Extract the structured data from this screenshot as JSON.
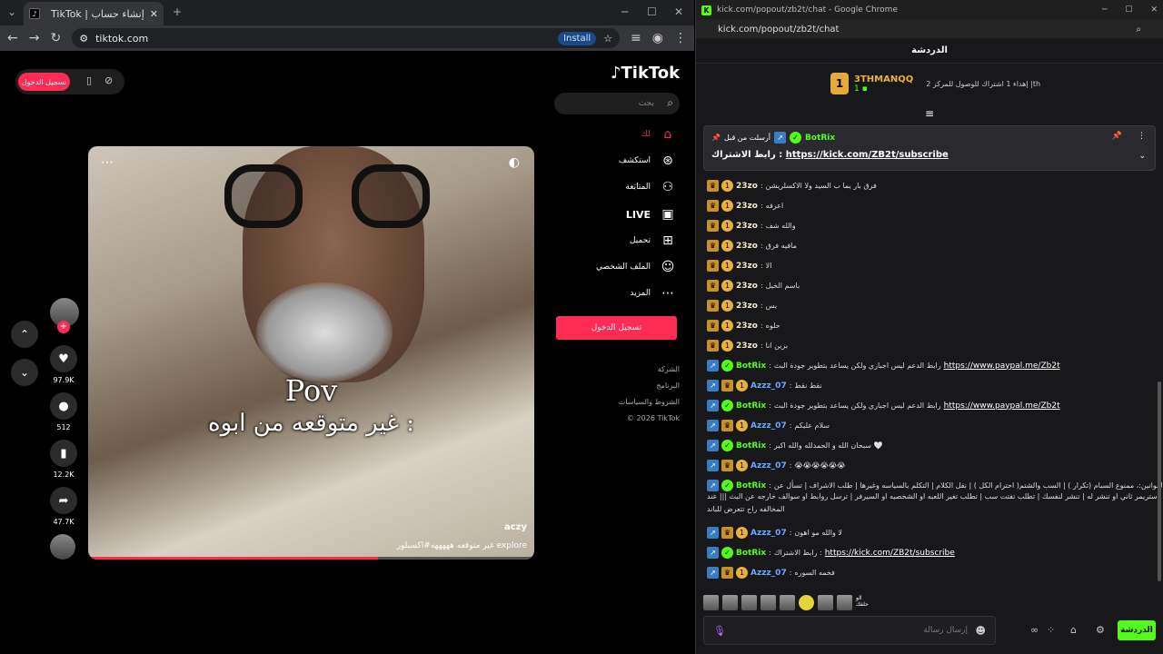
{
  "left_browser": {
    "tab_title": "TikTok | إنشاء حساب",
    "url": "tiktok.com",
    "install_label": "Install"
  },
  "tiktok": {
    "logo": "TikTok",
    "login_pill": "تسجيل الدخول",
    "search_placeholder": "بحث",
    "nav": [
      {
        "label": "لك",
        "icon": "home-icon"
      },
      {
        "label": "استكشف",
        "icon": "compass-icon"
      },
      {
        "label": "المتابَعة",
        "icon": "following-icon"
      },
      {
        "label": "LIVE",
        "icon": "live-icon"
      },
      {
        "label": "تحميل",
        "icon": "upload-icon"
      },
      {
        "label": "الملف الشخصي",
        "icon": "profile-icon"
      },
      {
        "label": "المزيد",
        "icon": "more-icon"
      }
    ],
    "login_button": "تسجيل الدخول",
    "footer": [
      "الشركة",
      "البرنامج",
      "الشروط والسياسات",
      "© 2026 TikTok"
    ],
    "video": {
      "overlay_title": "Pov",
      "overlay_text": "غير متوقعه من ابوه :",
      "username": "aczy",
      "caption": "غير متوقعه هههههه#اكسبلور explore",
      "progress": 0.65
    },
    "actions": {
      "likes": "97.9K",
      "comments": "512",
      "saves": "12.2K",
      "shares": "47.7K"
    }
  },
  "right_browser": {
    "title": "kick.com/popout/zb2t/chat - Google Chrome",
    "url": "kick.com/popout/zb2t/chat"
  },
  "kick": {
    "header": "الدردشة",
    "top_gifter": {
      "name": "3THMANQQ",
      "rank": "1",
      "count": "1"
    },
    "top_gift_note": "إهداء 1 اشتراك للوصول للمركز 2 |th",
    "pinned": {
      "by": "أرسلت من قبل",
      "user": "BotRix",
      "text": "رابط الاشتراك :",
      "link": "https://kick.com/ZB2t/subscribe"
    },
    "messages": [
      {
        "user": "23zo",
        "color": "#f0e6c8",
        "type": "sub",
        "text": "فرق بار يما ب السيد ولا الاكسلريشن"
      },
      {
        "user": "23zo",
        "color": "#f0e6c8",
        "type": "sub",
        "text": "اعرفه"
      },
      {
        "user": "23zo",
        "color": "#f0e6c8",
        "type": "sub",
        "text": "والله شف"
      },
      {
        "user": "23zo",
        "color": "#f0e6c8",
        "type": "sub",
        "text": "مافيه فرق"
      },
      {
        "user": "23zo",
        "color": "#f0e6c8",
        "type": "sub",
        "text": "الا"
      },
      {
        "user": "23zo",
        "color": "#f0e6c8",
        "type": "sub",
        "text": "باسم الخيل"
      },
      {
        "user": "23zo",
        "color": "#f0e6c8",
        "type": "sub",
        "text": "بس"
      },
      {
        "user": "23zo",
        "color": "#f0e6c8",
        "type": "sub",
        "text": "حلوه"
      },
      {
        "user": "23zo",
        "color": "#f0e6c8",
        "type": "sub",
        "text": "بزين انا"
      },
      {
        "user": "BotRix",
        "color": "#53fc18",
        "type": "bot",
        "text": "رابط الدعم ليس اجباري ولكن يساعد بتطوير جودة البث",
        "link": "https://www.paypal.me/Zb2t"
      },
      {
        "user": "Azzz_07",
        "color": "#6aa8ff",
        "type": "mod",
        "text": "نقط نقط"
      },
      {
        "user": "BotRix",
        "color": "#53fc18",
        "type": "bot",
        "text": "رابط الدعم ليس اجباري ولكن يساعد بتطوير جودة البث",
        "link": "https://www.paypal.me/Zb2t"
      },
      {
        "user": "Azzz_07",
        "color": "#6aa8ff",
        "type": "mod",
        "text": "سلام عليكم"
      },
      {
        "user": "BotRix",
        "color": "#53fc18",
        "type": "bot",
        "text": "سبحان الله و الحمدلله والله اكبر 🤍"
      },
      {
        "user": "Azzz_07",
        "color": "#6aa8ff",
        "type": "mod",
        "text": "😭😭😭😭😭😭"
      },
      {
        "user": "BotRix",
        "color": "#53fc18",
        "type": "bot",
        "text": "القوانين:، ممنوع السبام (تكرار ) | السب والشتم( احترام الكل ) | نقل الكلام | التكلم بالسياسه وغيرها | طلب الاشراف | تسأل عن",
        "line2": "استريمر ثاني او تنشر له | تنشر لنفسك | تطلب تفتت سب | تطلب تغير اللعبه او الشخصيه او السيرفر | ترسل روابط او سوالف خارجه عن البث ||| عند",
        "line3": "المخالفه راح تتعرض للباند"
      },
      {
        "user": "Azzz_07",
        "color": "#6aa8ff",
        "type": "mod",
        "text": "لا والله مو اهون"
      },
      {
        "user": "BotRix",
        "color": "#53fc18",
        "type": "bot",
        "text": "رابط الاشتراك :",
        "link": "https://kick.com/ZB2t/subscribe"
      },
      {
        "user": "Azzz_07",
        "color": "#6aa8ff",
        "type": "mod",
        "text": "فخمه السوره"
      }
    ],
    "input_placeholder": "إرسال رسالة",
    "chat_button": "الدردشة",
    "emote_label": "الو حلفك"
  }
}
